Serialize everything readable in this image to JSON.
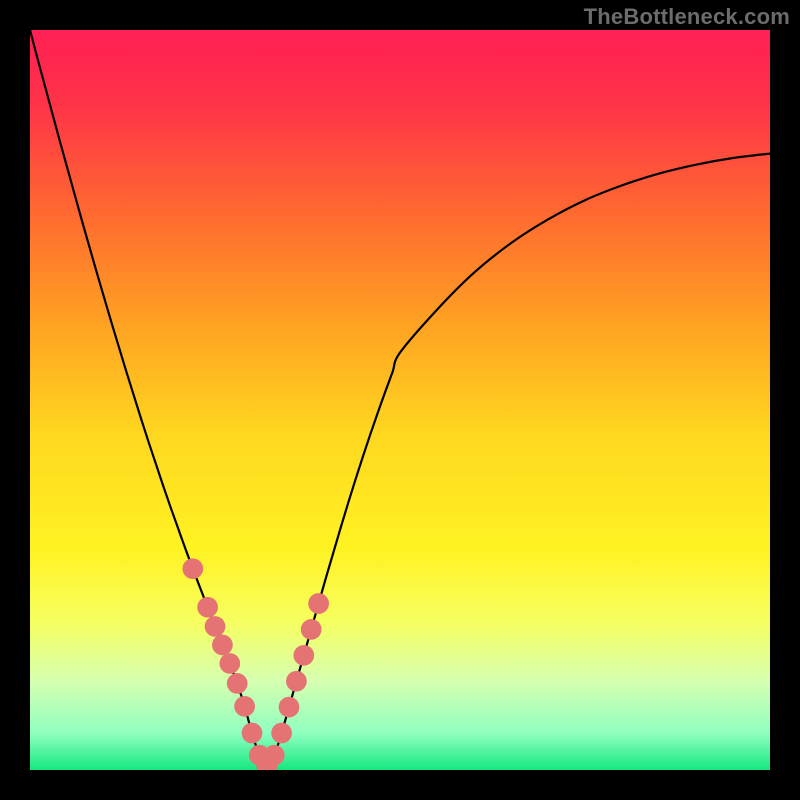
{
  "watermark": "TheBottleneck.com",
  "gradient": {
    "stops": [
      {
        "pos": 0.0,
        "color": "#ff1f55"
      },
      {
        "pos": 0.1,
        "color": "#ff3348"
      },
      {
        "pos": 0.25,
        "color": "#ff6a30"
      },
      {
        "pos": 0.4,
        "color": "#ffa322"
      },
      {
        "pos": 0.55,
        "color": "#ffd820"
      },
      {
        "pos": 0.7,
        "color": "#fff222"
      },
      {
        "pos": 0.8,
        "color": "#f6ff60"
      },
      {
        "pos": 0.88,
        "color": "#d6ffb0"
      },
      {
        "pos": 0.95,
        "color": "#90ffc0"
      },
      {
        "pos": 1.0,
        "color": "#15e880"
      }
    ]
  },
  "chart_data": {
    "type": "line",
    "title": "",
    "xlabel": "",
    "ylabel": "",
    "xlim": [
      0,
      100
    ],
    "ylim": [
      0,
      100
    ],
    "grid": false,
    "legend": false,
    "x": [
      0,
      1,
      2,
      3,
      4,
      5,
      6,
      7,
      8,
      9,
      10,
      11,
      12,
      13,
      14,
      15,
      16,
      17,
      18,
      19,
      20,
      21,
      22,
      23,
      24,
      25,
      26,
      27,
      28,
      29,
      30,
      31,
      32,
      33,
      34,
      35,
      36,
      37,
      38,
      39,
      40,
      41,
      42,
      43,
      44,
      45,
      46,
      47,
      48,
      49,
      50,
      55,
      60,
      65,
      70,
      75,
      80,
      85,
      90,
      95,
      100
    ],
    "y": [
      100,
      96.2,
      92.5,
      88.8,
      85.1,
      81.5,
      77.9,
      74.3,
      70.8,
      67.3,
      63.9,
      60.5,
      57.2,
      53.9,
      50.7,
      47.5,
      44.4,
      41.4,
      38.4,
      35.5,
      32.7,
      29.9,
      27.2,
      24.6,
      22.0,
      19.4,
      16.9,
      14.4,
      11.7,
      8.6,
      5.0,
      2.0,
      0.5,
      2.0,
      5.0,
      8.5,
      12.0,
      15.5,
      19.0,
      22.5,
      26.0,
      29.4,
      32.8,
      36.1,
      39.3,
      42.4,
      45.4,
      48.3,
      51.1,
      53.8,
      56.4,
      62.2,
      67.2,
      71.2,
      74.4,
      77.0,
      79.0,
      80.6,
      81.8,
      82.7,
      83.3
    ],
    "marker_indices_left": [
      22,
      24,
      25,
      26,
      27,
      28,
      29,
      30,
      31
    ],
    "marker_indices_right": [
      31,
      32,
      33,
      34,
      35,
      36,
      37,
      38,
      39
    ],
    "marker_color": "#e57373",
    "marker_radius_plot_units": 1.4,
    "curve_stroke": "#000000",
    "curve_stroke_width_px": 2.2
  }
}
